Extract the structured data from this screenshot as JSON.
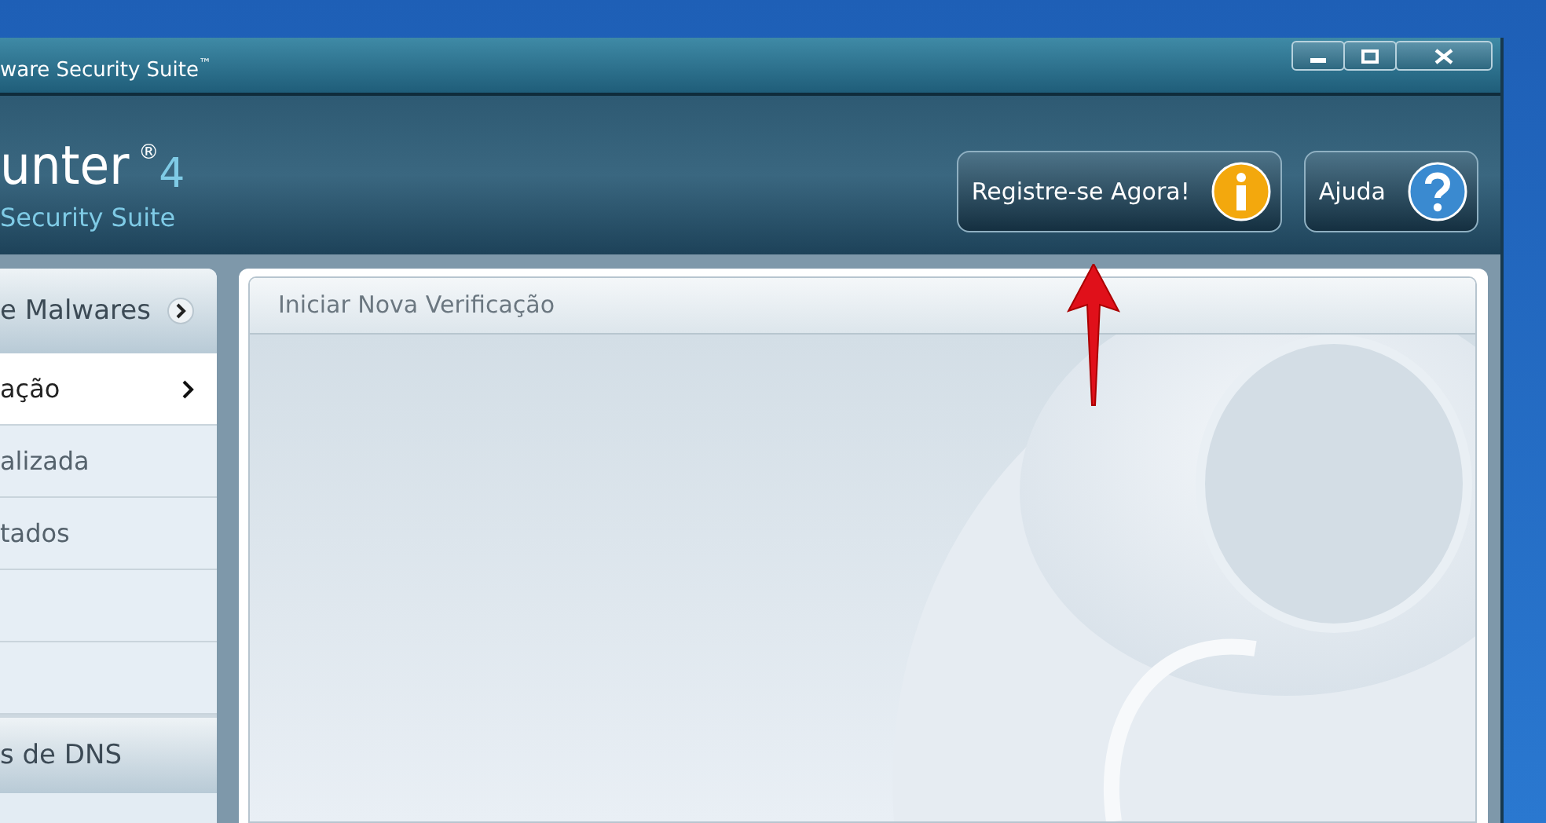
{
  "window": {
    "title": "ware Security Suite",
    "title_mark": "™"
  },
  "header": {
    "logo": {
      "name": "unter",
      "mark": "®",
      "version": "4",
      "tagline": "Security Suite"
    },
    "buttons": [
      {
        "label": "Registre-se Agora!",
        "kind": "info"
      },
      {
        "label": "Ajuda",
        "kind": "help"
      }
    ]
  },
  "sidebar": {
    "section": "e Malwares",
    "items": [
      {
        "label": "ação",
        "selected": true
      },
      {
        "label": "alizada",
        "selected": false
      },
      {
        "label": "tados",
        "selected": false
      }
    ],
    "next_section": "s de DNS"
  },
  "panel": {
    "title": "Iniciar Nova Verificação"
  }
}
